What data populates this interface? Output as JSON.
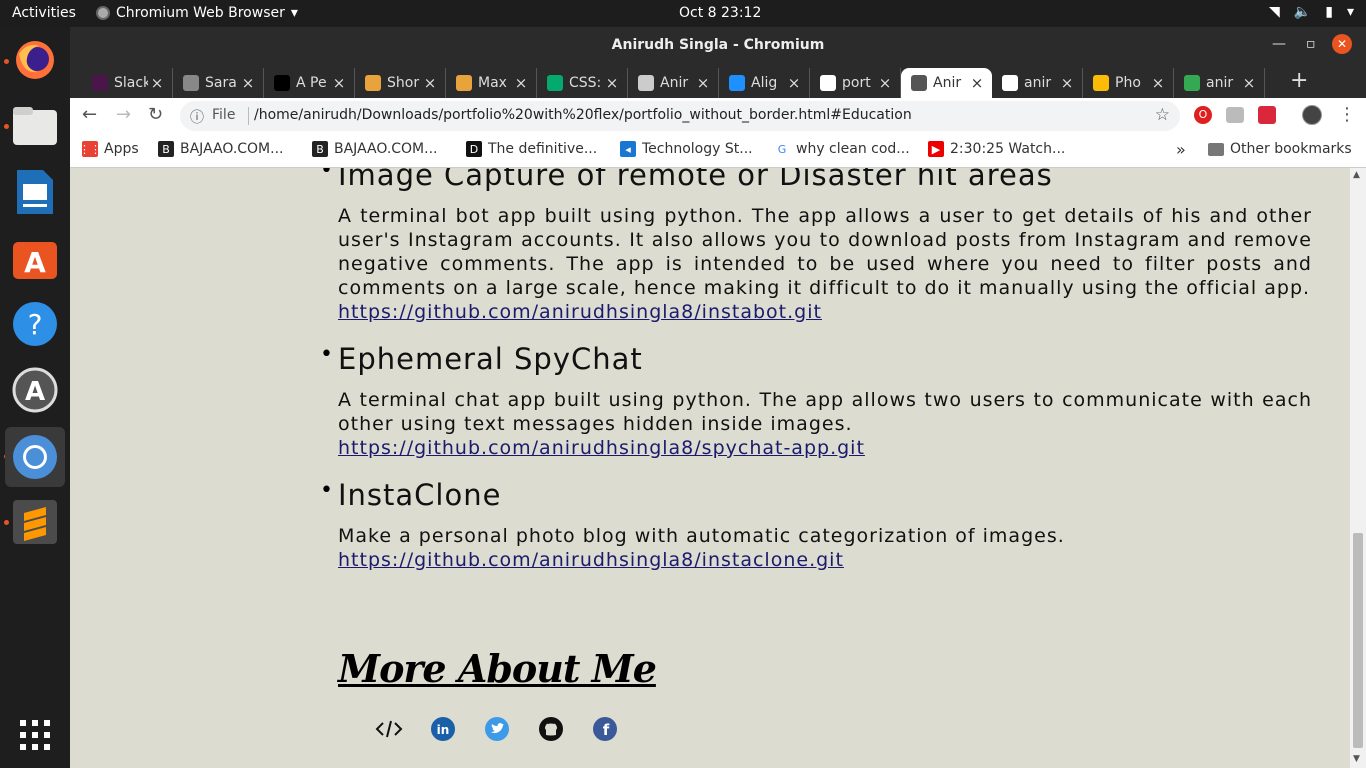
{
  "topbar": {
    "activities": "Activities",
    "app_name": "Chromium Web Browser",
    "clock": "Oct 8  23:12"
  },
  "dock": {
    "items": [
      "firefox-icon",
      "files-icon",
      "libreoffice-impress-icon",
      "software-center-icon",
      "help-icon",
      "software-updater-icon",
      "chromium-icon",
      "sublime-text-icon",
      "show-apps-icon"
    ]
  },
  "window": {
    "title": "Anirudh Singla - Chromium"
  },
  "tabs": [
    {
      "label": "Slack",
      "icon": "slack-icon",
      "color": "#4a154b"
    },
    {
      "label": "Sara",
      "icon": "s-icon",
      "color": "#888888"
    },
    {
      "label": "A Pe",
      "icon": "codepen-icon",
      "color": "#000000"
    },
    {
      "label": "Shor",
      "icon": "dev-icon",
      "color": "#e8a33d"
    },
    {
      "label": "Max",
      "icon": "dev-icon",
      "color": "#e8a33d"
    },
    {
      "label": "CSS:",
      "icon": "w3-icon",
      "color": "#04aa6d"
    },
    {
      "label": "Anir",
      "icon": "globe-icon",
      "color": "#cccccc"
    },
    {
      "label": "Alig",
      "icon": "stack-icon",
      "color": "#1e90ff"
    },
    {
      "label": "port",
      "icon": "github-icon",
      "color": "#ffffff"
    },
    {
      "label": "Anir",
      "icon": "globe-icon",
      "color": "#555555",
      "active": true
    },
    {
      "label": "anir",
      "icon": "github-icon",
      "color": "#ffffff"
    },
    {
      "label": "Pho",
      "icon": "photos-icon",
      "color": "#fbbc05"
    },
    {
      "label": "anir",
      "icon": "app-icon",
      "color": "#34a853"
    }
  ],
  "omnibox": {
    "scheme": "File",
    "url": "/home/anirudh/Downloads/portfolio%20with%20flex/portfolio_without_border.html#Education"
  },
  "bookmarks": {
    "items": [
      {
        "label": "Apps",
        "icon": "apps-grid-icon"
      },
      {
        "label": "BAJAAO.COM...",
        "icon": "b-icon"
      },
      {
        "label": "BAJAAO.COM...",
        "icon": "b-icon"
      },
      {
        "label": "The definitive...",
        "icon": "d-icon"
      },
      {
        "label": "Technology St...",
        "icon": "tech-icon"
      },
      {
        "label": "why clean cod...",
        "icon": "google-icon"
      },
      {
        "label": "2:30:25 Watch...",
        "icon": "youtube-icon"
      }
    ],
    "overflow": "»",
    "other": "Other bookmarks"
  },
  "projects": [
    {
      "title": "Image Capture of remote or Disaster hit areas",
      "description": "A terminal bot app built using python. The app allows a user to get details of his and other user's Instagram accounts. It also allows you to download posts from Instagram and remove negative comments. The app is intended to be used where you need to filter posts and comments on a large scale, hence making it difficult to do it manually using the official app.",
      "link": "https://github.com/anirudhsingla8/instabot.git"
    },
    {
      "title": "Ephemeral SpyChat",
      "description": "A terminal chat app built using python. The app allows two users to communicate with each other using text messages hidden inside images.",
      "link": "https://github.com/anirudhsingla8/spychat-app.git"
    },
    {
      "title": "InstaClone",
      "description": "Make a personal photo blog with automatic categorization of images.",
      "link": "https://github.com/anirudhsingla8/instaclone.git"
    }
  ],
  "more": {
    "heading": "More About Me",
    "social": [
      "code-icon",
      "linkedin-icon",
      "twitter-icon",
      "github-icon",
      "facebook-icon"
    ]
  }
}
